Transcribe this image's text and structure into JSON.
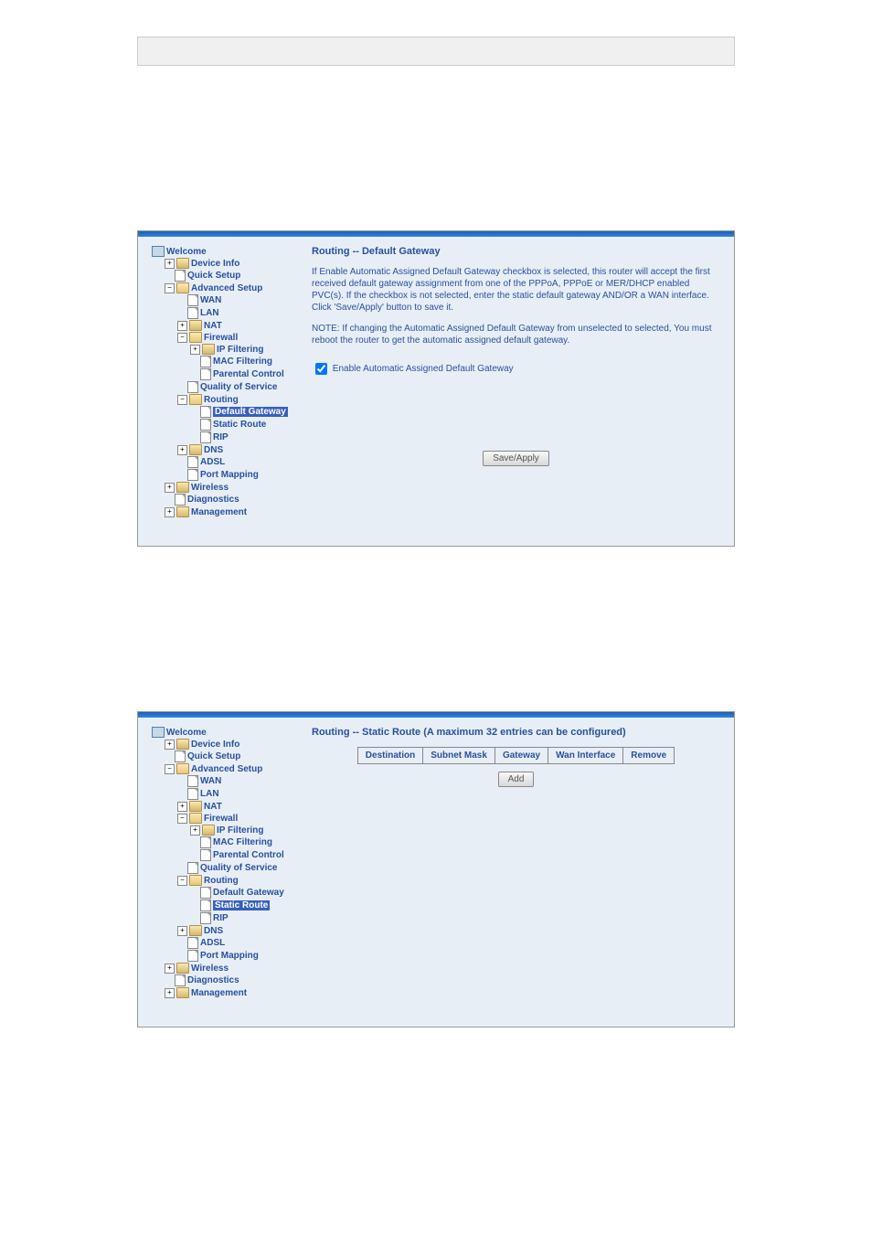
{
  "nav": {
    "welcome": "Welcome",
    "device_info": "Device Info",
    "quick_setup": "Quick Setup",
    "advanced_setup": "Advanced Setup",
    "wan": "WAN",
    "lan": "LAN",
    "nat": "NAT",
    "firewall": "Firewall",
    "ip_filtering": "IP Filtering",
    "mac_filtering": "MAC Filtering",
    "parental_control": "Parental Control",
    "qos": "Quality of Service",
    "routing": "Routing",
    "default_gateway": "Default Gateway",
    "static_route": "Static Route",
    "rip": "RIP",
    "dns": "DNS",
    "adsl": "ADSL",
    "port_mapping": "Port Mapping",
    "wireless": "Wireless",
    "diagnostics": "Diagnostics",
    "management": "Management"
  },
  "panel1": {
    "title": "Routing -- Default Gateway",
    "para1": "If Enable Automatic Assigned Default Gateway checkbox is selected, this router will accept the first received default gateway assignment from one of the PPPoA, PPPoE or MER/DHCP enabled PVC(s). If the checkbox is not selected, enter the static default gateway AND/OR a WAN interface. Click 'Save/Apply' button to save it.",
    "para2": "NOTE: If changing the Automatic Assigned Default Gateway from unselected to selected, You must reboot the router to get the automatic assigned default gateway.",
    "checkbox_label": "Enable Automatic Assigned Default Gateway",
    "save_apply": "Save/Apply"
  },
  "panel2": {
    "title": "Routing -- Static Route (A maximum 32 entries can be configured)",
    "columns": [
      "Destination",
      "Subnet Mask",
      "Gateway",
      "Wan Interface",
      "Remove"
    ],
    "add_button": "Add"
  }
}
